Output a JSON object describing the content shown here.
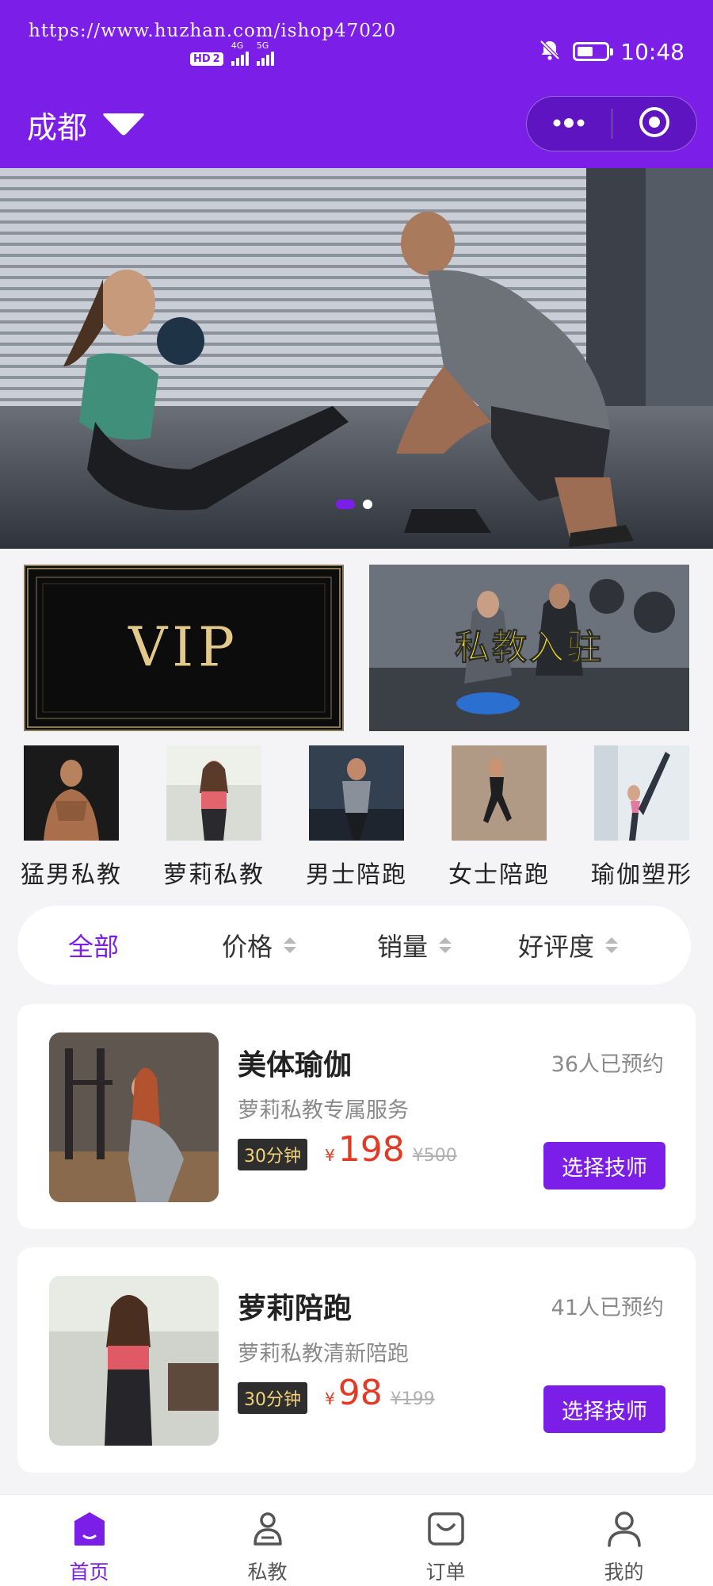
{
  "theme": {
    "accent": "#7b1fe8",
    "price": "#e23a24",
    "tag_bg": "#2e2e2e",
    "tag_text": "#f3d27a"
  },
  "status_bar": {
    "watermark": "https://www.huzhan.com/ishop47020",
    "hd_badge": "HD",
    "sim_number": "2",
    "network_1": "4G",
    "network_2": "5G",
    "time": "10:48",
    "battery_level": 0.55,
    "icons": [
      "mute-bell-icon",
      "battery-icon"
    ]
  },
  "nav": {
    "city": "成都",
    "city_icon": "triangle-down-icon",
    "capsule": {
      "more_icon": "more-dots-icon",
      "close_icon": "target-close-icon"
    }
  },
  "banner": {
    "slides": 2,
    "active_slide": 1
  },
  "promos": [
    {
      "id": "vip",
      "text": "VIP"
    },
    {
      "id": "coach",
      "text": "私教入驻"
    }
  ],
  "categories": [
    {
      "label": "猛男私教"
    },
    {
      "label": "萝莉私教"
    },
    {
      "label": "男士陪跑"
    },
    {
      "label": "女士陪跑"
    },
    {
      "label": "瑜伽塑形"
    }
  ],
  "filter": {
    "items": [
      {
        "label": "全部",
        "active": true
      },
      {
        "label": "价格",
        "active": false
      },
      {
        "label": "销量",
        "active": false
      },
      {
        "label": "好评度",
        "active": false
      }
    ]
  },
  "services": [
    {
      "title": "美体瑜伽",
      "booked": "36人已预约",
      "subtitle": "萝莉私教专属服务",
      "duration": "30分钟",
      "currency": "¥",
      "price": "198",
      "original_price": "¥500",
      "button": "选择技师"
    },
    {
      "title": "萝莉陪跑",
      "booked": "41人已预约",
      "subtitle": "萝莉私教清新陪跑",
      "duration": "30分钟",
      "currency": "¥",
      "price": "98",
      "original_price": "¥199",
      "button": "选择技师"
    }
  ],
  "tabbar": [
    {
      "label": "首页",
      "icon": "home-icon",
      "active": true
    },
    {
      "label": "私教",
      "icon": "coach-icon",
      "active": false
    },
    {
      "label": "订单",
      "icon": "order-icon",
      "active": false
    },
    {
      "label": "我的",
      "icon": "profile-icon",
      "active": false
    }
  ]
}
